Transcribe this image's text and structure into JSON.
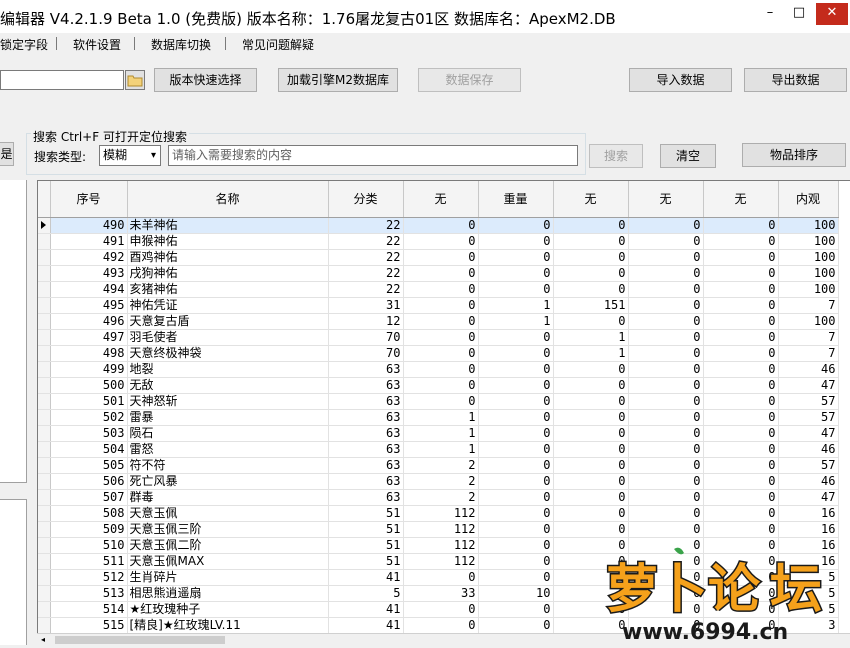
{
  "window": {
    "title": "编辑器 V4.2.1.9   Beta 1.0 (免费版)    版本名称：1.76屠龙复古01区    数据库名：ApexM2.DB",
    "minimize_glyph": "–",
    "maximize_glyph": "□",
    "close_glyph": "✕"
  },
  "menu": {
    "items": [
      "锁定字段",
      "软件设置",
      "数据库切换",
      "常见问题解疑"
    ]
  },
  "toolbar": {
    "version_quick_select": "版本快速选择",
    "load_engine_db": "加载引擎M2数据库",
    "save_data": "数据保存",
    "import_data": "导入数据",
    "export_data": "导出数据"
  },
  "search": {
    "legend": "搜索   Ctrl+F 可打开定位搜索",
    "type_label": "搜索类型:",
    "type_value": "模糊",
    "placeholder": "请输入需要搜索的内容",
    "search_button": "搜索",
    "clear_button": "清空",
    "sort_button": "物品排序",
    "left_tab_fragment": "是"
  },
  "grid": {
    "columns": [
      "序号",
      "名称",
      "分类",
      "无",
      "重量",
      "无",
      "无",
      "无",
      "内观"
    ],
    "rows": [
      [
        "490",
        "未羊神佑",
        "22",
        "0",
        "0",
        "0",
        "0",
        "0",
        "100"
      ],
      [
        "491",
        "申猴神佑",
        "22",
        "0",
        "0",
        "0",
        "0",
        "0",
        "100"
      ],
      [
        "492",
        "酉鸡神佑",
        "22",
        "0",
        "0",
        "0",
        "0",
        "0",
        "100"
      ],
      [
        "493",
        "戌狗神佑",
        "22",
        "0",
        "0",
        "0",
        "0",
        "0",
        "100"
      ],
      [
        "494",
        "亥猪神佑",
        "22",
        "0",
        "0",
        "0",
        "0",
        "0",
        "100"
      ],
      [
        "495",
        "神佑凭证",
        "31",
        "0",
        "1",
        "151",
        "0",
        "0",
        "7"
      ],
      [
        "496",
        "天意复古盾",
        "12",
        "0",
        "1",
        "0",
        "0",
        "0",
        "100"
      ],
      [
        "497",
        "羽毛使者",
        "70",
        "0",
        "0",
        "1",
        "0",
        "0",
        "7"
      ],
      [
        "498",
        "天意终极神袋",
        "70",
        "0",
        "0",
        "1",
        "0",
        "0",
        "7"
      ],
      [
        "499",
        "地裂",
        "63",
        "0",
        "0",
        "0",
        "0",
        "0",
        "46"
      ],
      [
        "500",
        "无敌",
        "63",
        "0",
        "0",
        "0",
        "0",
        "0",
        "47"
      ],
      [
        "501",
        "天神怒斩",
        "63",
        "0",
        "0",
        "0",
        "0",
        "0",
        "57"
      ],
      [
        "502",
        "雷暴",
        "63",
        "1",
        "0",
        "0",
        "0",
        "0",
        "57"
      ],
      [
        "503",
        "陨石",
        "63",
        "1",
        "0",
        "0",
        "0",
        "0",
        "47"
      ],
      [
        "504",
        "雷怒",
        "63",
        "1",
        "0",
        "0",
        "0",
        "0",
        "46"
      ],
      [
        "505",
        "符不符",
        "63",
        "2",
        "0",
        "0",
        "0",
        "0",
        "57"
      ],
      [
        "506",
        "死亡风暴",
        "63",
        "2",
        "0",
        "0",
        "0",
        "0",
        "46"
      ],
      [
        "507",
        "群毒",
        "63",
        "2",
        "0",
        "0",
        "0",
        "0",
        "47"
      ],
      [
        "508",
        "天意玉佩",
        "51",
        "112",
        "0",
        "0",
        "0",
        "0",
        "16"
      ],
      [
        "509",
        "天意玉佩三阶",
        "51",
        "112",
        "0",
        "0",
        "0",
        "0",
        "16"
      ],
      [
        "510",
        "天意玉佩二阶",
        "51",
        "112",
        "0",
        "0",
        "0",
        "0",
        "16"
      ],
      [
        "511",
        "天意玉佩MAX",
        "51",
        "112",
        "0",
        "0",
        "0",
        "0",
        "16"
      ],
      [
        "512",
        "生肖碎片",
        "41",
        "0",
        "0",
        "0",
        "0",
        "0",
        "5"
      ],
      [
        "513",
        "相思熊逍遥扇",
        "5",
        "33",
        "10",
        "0",
        "0",
        "0",
        "5"
      ],
      [
        "514",
        "★红玫瑰种子",
        "41",
        "0",
        "0",
        "0",
        "0",
        "0",
        "5"
      ],
      [
        "515",
        "[精良]★红玫瑰LV.11",
        "41",
        "0",
        "0",
        "0",
        "0",
        "0",
        "3"
      ]
    ]
  },
  "watermark": {
    "logo_text": "萝卜论坛",
    "url": "www.6994.cn"
  },
  "colors": {
    "close_red": "#c42b1c",
    "selected_row": "#dcebfc",
    "logo_orange": "#f5a11b",
    "logo_outline": "#1a1a1a"
  }
}
